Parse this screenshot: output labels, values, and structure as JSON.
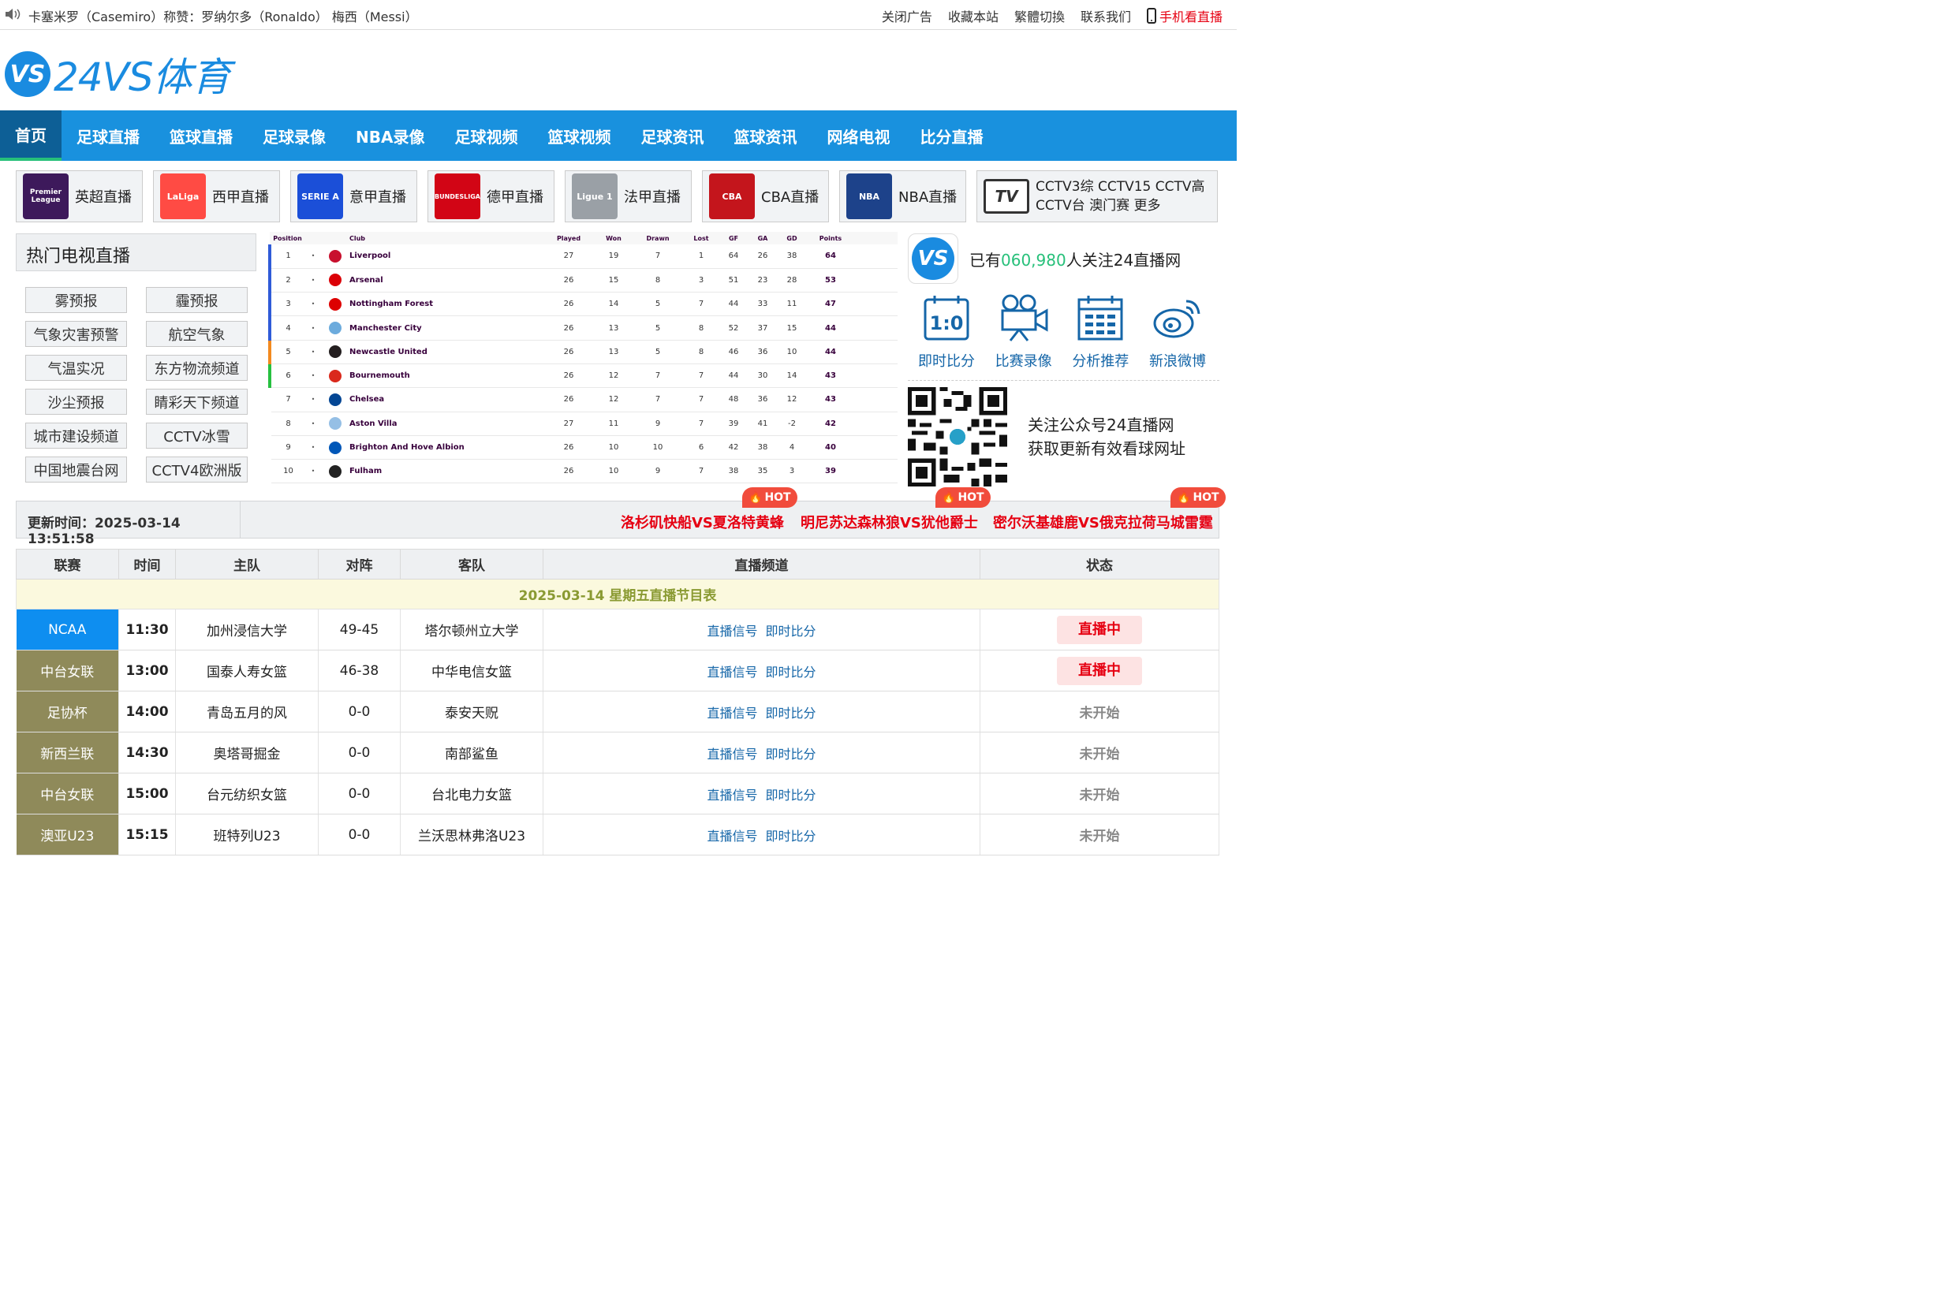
{
  "topbar": {
    "notice": "卡塞米罗（Casemiro）称赞：罗纳尔多（Ronaldo） 梅西（Messi）",
    "links": [
      "关闭广告",
      "收藏本站",
      "繁體切換",
      "联系我们"
    ],
    "mobile": "手机看直播"
  },
  "logo": {
    "mark": "VS",
    "text": "24VS体育"
  },
  "nav": [
    "首页",
    "足球直播",
    "篮球直播",
    "足球录像",
    "NBA录像",
    "足球视频",
    "篮球视频",
    "足球资讯",
    "篮球资讯",
    "网络电视",
    "比分直播"
  ],
  "leagues": [
    {
      "label": "英超直播",
      "icon": "Premier League",
      "color": "#3d195b"
    },
    {
      "label": "西甲直播",
      "icon": "LaLiga",
      "color": "#ff4b44"
    },
    {
      "label": "意甲直播",
      "icon": "SERIE A",
      "color": "#1b4fd8"
    },
    {
      "label": "德甲直播",
      "icon": "BUNDESLIGA",
      "color": "#d20515"
    },
    {
      "label": "法甲直播",
      "icon": "Ligue 1",
      "color": "#9aa0a6"
    },
    {
      "label": "CBA直播",
      "icon": "CBA",
      "color": "#c4151c"
    },
    {
      "label": "NBA直播",
      "icon": "NBA",
      "color": "#1d428a"
    }
  ],
  "cctv": {
    "icon": "TV",
    "text": "CCTV3综 CCTV15 CCTV高 CCTV台 澳门赛 更多"
  },
  "tv": {
    "title": "热门电视直播",
    "items": [
      "雾预报",
      "霾预报",
      "气象灾害预警",
      "航空气象",
      "气温实况",
      "东方物流频道",
      "沙尘预报",
      "睛彩天下频道",
      "城市建设频道",
      "CCTV冰雪",
      "中国地震台网",
      "CCTV4欧洲版"
    ]
  },
  "standings": {
    "headers": [
      "Position",
      "Club",
      "Played",
      "Won",
      "Drawn",
      "Lost",
      "GF",
      "GA",
      "GD",
      "Points"
    ],
    "rows": [
      {
        "pos": "1",
        "club": "Liverpool",
        "p": "27",
        "w": "19",
        "d": "7",
        "l": "1",
        "gf": "64",
        "ga": "26",
        "gd": "38",
        "pts": "64",
        "zone": "cl",
        "color": "#c8102e"
      },
      {
        "pos": "2",
        "club": "Arsenal",
        "p": "26",
        "w": "15",
        "d": "8",
        "l": "3",
        "gf": "51",
        "ga": "23",
        "gd": "28",
        "pts": "53",
        "zone": "cl",
        "color": "#db0007"
      },
      {
        "pos": "3",
        "club": "Nottingham Forest",
        "p": "26",
        "w": "14",
        "d": "5",
        "l": "7",
        "gf": "44",
        "ga": "33",
        "gd": "11",
        "pts": "47",
        "zone": "cl",
        "color": "#dd0000"
      },
      {
        "pos": "4",
        "club": "Manchester City",
        "p": "26",
        "w": "13",
        "d": "5",
        "l": "8",
        "gf": "52",
        "ga": "37",
        "gd": "15",
        "pts": "44",
        "zone": "cl",
        "color": "#6cabdd"
      },
      {
        "pos": "5",
        "club": "Newcastle United",
        "p": "26",
        "w": "13",
        "d": "5",
        "l": "8",
        "gf": "46",
        "ga": "36",
        "gd": "10",
        "pts": "44",
        "zone": "el",
        "color": "#241f20"
      },
      {
        "pos": "6",
        "club": "Bournemouth",
        "p": "26",
        "w": "12",
        "d": "7",
        "l": "7",
        "gf": "44",
        "ga": "30",
        "gd": "14",
        "pts": "43",
        "zone": "co",
        "color": "#da291c"
      },
      {
        "pos": "7",
        "club": "Chelsea",
        "p": "26",
        "w": "12",
        "d": "7",
        "l": "7",
        "gf": "48",
        "ga": "36",
        "gd": "12",
        "pts": "43",
        "zone": "",
        "color": "#034694"
      },
      {
        "pos": "8",
        "club": "Aston Villa",
        "p": "27",
        "w": "11",
        "d": "9",
        "l": "7",
        "gf": "39",
        "ga": "41",
        "gd": "-2",
        "pts": "42",
        "zone": "",
        "color": "#95bfe5"
      },
      {
        "pos": "9",
        "club": "Brighton And Hove Albion",
        "p": "26",
        "w": "10",
        "d": "10",
        "l": "6",
        "gf": "42",
        "ga": "38",
        "gd": "4",
        "pts": "40",
        "zone": "",
        "color": "#0057b8"
      },
      {
        "pos": "10",
        "club": "Fulham",
        "p": "26",
        "w": "10",
        "d": "9",
        "l": "7",
        "gf": "38",
        "ga": "35",
        "gd": "3",
        "pts": "39",
        "zone": "",
        "color": "#222222"
      }
    ]
  },
  "follow": {
    "prefix": "已有",
    "count": "060,980",
    "suffix": "人关注24直播网",
    "icons": [
      "即时比分",
      "比赛录像",
      "分析推荐",
      "新浪微博"
    ],
    "qr_line1": "关注公众号24直播网",
    "qr_line2": "获取更新有效看球网址"
  },
  "hotbar": {
    "update_label": "更新时间：",
    "update_time": "2025-03-14 13:51:58",
    "badge": "HOT",
    "hot": [
      "洛杉矶快船VS夏洛特黄蜂",
      "明尼苏达森林狼VS犹他爵士",
      "密尔沃基雄鹿VS俄克拉荷马城雷霆"
    ]
  },
  "schedule": {
    "headers": [
      "联赛",
      "时间",
      "主队",
      "对阵",
      "客队",
      "直播频道",
      "状态"
    ],
    "date_row": "2025-03-14 星期五直播节目表",
    "link_signal": "直播信号",
    "link_score": "即时比分",
    "rows": [
      {
        "league": "NCAA",
        "color": "#0e8ef0",
        "time": "11:30",
        "home": "加州浸信大学",
        "score": "49-45",
        "away": "塔尔顿州立大学",
        "status": "直播中",
        "live": true
      },
      {
        "league": "中台女联",
        "color": "#8f8a5a",
        "time": "13:00",
        "home": "国泰人寿女篮",
        "score": "46-38",
        "away": "中华电信女篮",
        "status": "直播中",
        "live": true
      },
      {
        "league": "足协杯",
        "color": "#8f8a5a",
        "time": "14:00",
        "home": "青岛五月的风",
        "score": "0-0",
        "away": "泰安天贶",
        "status": "未开始",
        "live": false
      },
      {
        "league": "新西兰联",
        "color": "#8f8a5a",
        "time": "14:30",
        "home": "奥塔哥掘金",
        "score": "0-0",
        "away": "南部鲨鱼",
        "status": "未开始",
        "live": false
      },
      {
        "league": "中台女联",
        "color": "#8f8a5a",
        "time": "15:00",
        "home": "台元纺织女篮",
        "score": "0-0",
        "away": "台北电力女篮",
        "status": "未开始",
        "live": false
      },
      {
        "league": "澳亚U23",
        "color": "#8f8a5a",
        "time": "15:15",
        "home": "班特列U23",
        "score": "0-0",
        "away": "兰沃思林弗洛U23",
        "status": "未开始",
        "live": false
      }
    ]
  }
}
